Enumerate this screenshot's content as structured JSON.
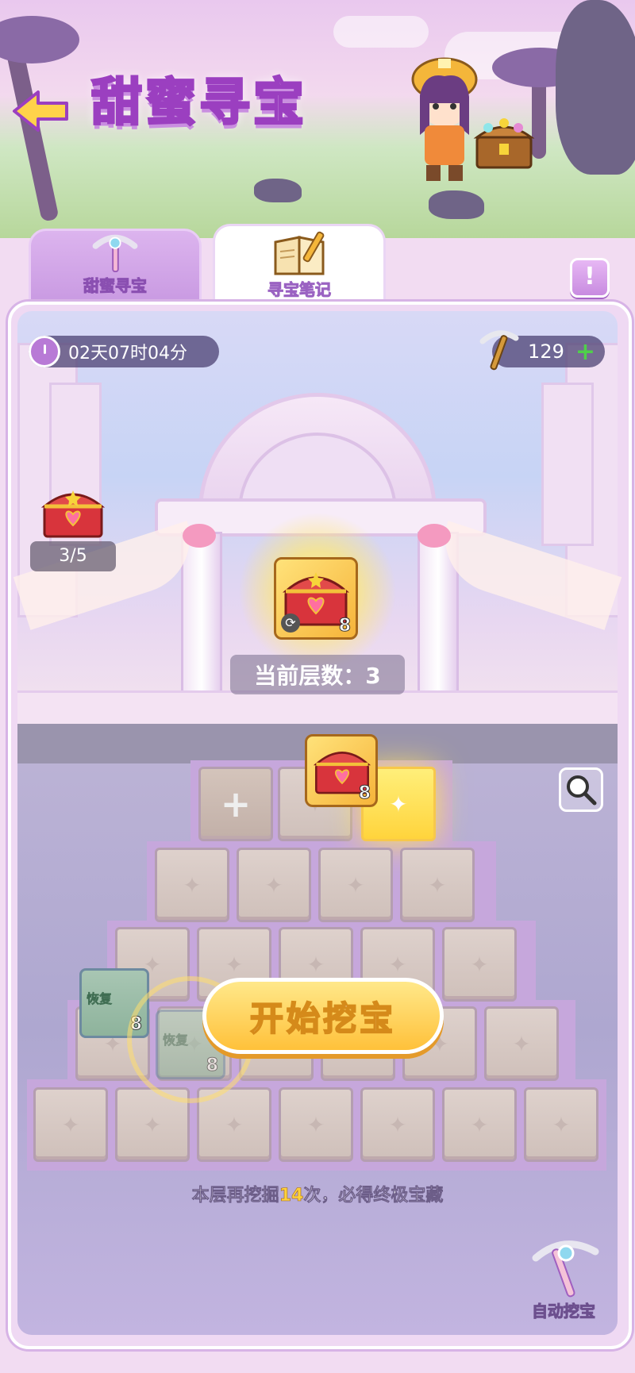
{
  "header": {
    "title": "甜蜜寻宝"
  },
  "tabs": [
    {
      "label": "甜蜜寻宝",
      "icon": "pickaxe-icon"
    },
    {
      "label": "寻宝笔记",
      "icon": "notebook-icon",
      "active": true
    }
  ],
  "status": {
    "timer": "02天07时04分",
    "pickaxes": "129"
  },
  "stage": {
    "progress": "3/5",
    "reward_count": "8",
    "level_label": "当前层数：3"
  },
  "dig": {
    "reveal_count": "8",
    "item_label": "恢复",
    "item_count": "8",
    "start_label": "开始挖宝",
    "hint_prefix": "本层再挖掘",
    "hint_num": "14",
    "hint_suffix": "次，必得终极宝藏",
    "auto_label": "自动挖宝"
  },
  "colors": {
    "accent": "#c88be0",
    "gold": "#ffc13a",
    "plus": "#4fd04a"
  }
}
